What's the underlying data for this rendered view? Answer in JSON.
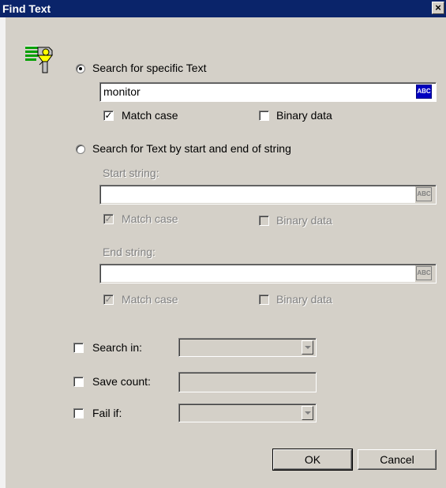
{
  "window": {
    "title": "Find Text",
    "close_symbol": "×"
  },
  "search_specific": {
    "label": "Search for specific Text",
    "value": "monitor",
    "abc_label": "ABC",
    "match_case_label": "Match case",
    "match_case_checked": true,
    "binary_label": "Binary data",
    "binary_checked": false
  },
  "search_start_end": {
    "label": "Search for Text by start and end of string",
    "start_label": "Start string:",
    "start_value": "",
    "end_label": "End string:",
    "end_value": "",
    "abc_label": "ABC",
    "match_case_label": "Match case",
    "binary_label": "Binary data"
  },
  "options": {
    "search_in_label": "Search in:",
    "save_count_label": "Save count:",
    "fail_if_label": "Fail if:"
  },
  "buttons": {
    "ok": "OK",
    "cancel": "Cancel"
  },
  "colors": {
    "title_bar": "#0a246a",
    "dialog_bg": "#d4d0c8",
    "abc_active": "#0000c0"
  }
}
